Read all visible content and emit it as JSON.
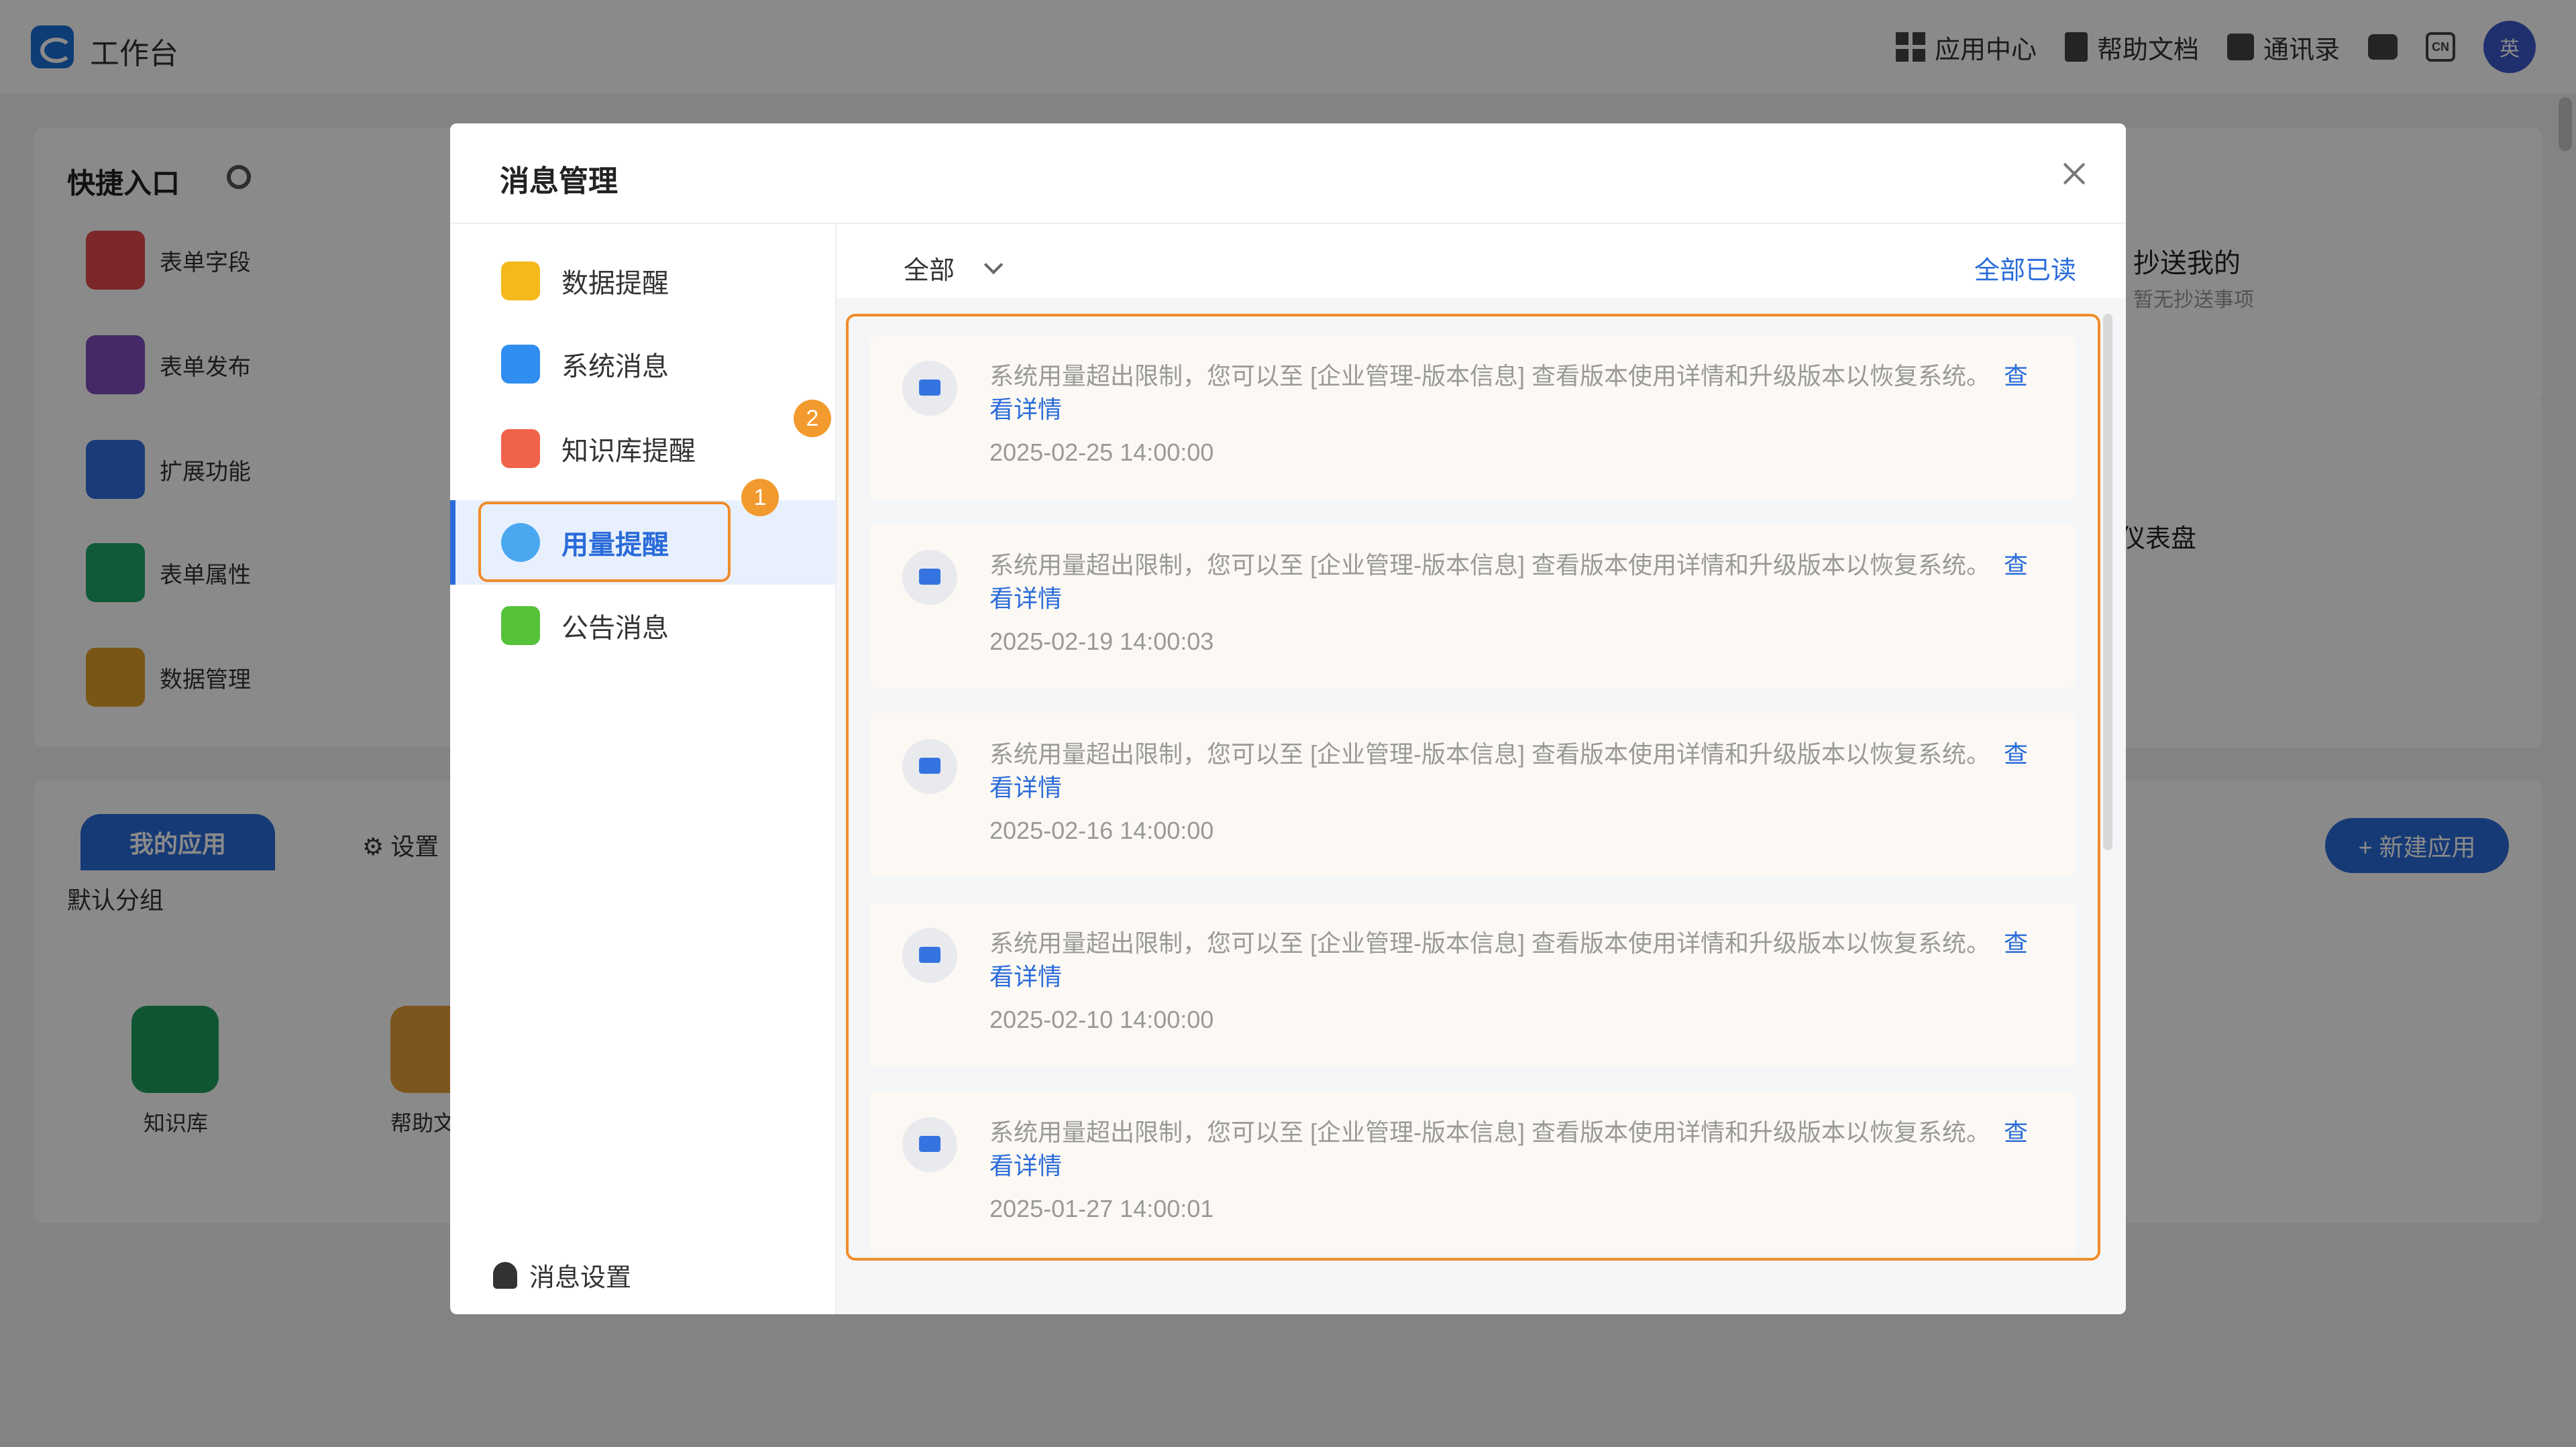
{
  "app": {
    "title": "工作台",
    "nav": [
      "应用中心",
      "帮助文档",
      "通讯录"
    ],
    "lang_icon_text": "CN",
    "avatar_text": "英"
  },
  "quick_entry": {
    "title": "快捷入口",
    "items": [
      {
        "label": "表单字段",
        "color": "#e5484d"
      },
      {
        "label": "表单发布",
        "color": "#7c4dbd"
      },
      {
        "label": "扩展功能",
        "color": "#2f6fe0"
      },
      {
        "label": "表单属性",
        "color": "#1fa56a"
      },
      {
        "label": "数据管理",
        "color": "#e0a02a"
      }
    ]
  },
  "cc_panel": {
    "title": "抄送我的",
    "sub": "暂无抄送事项"
  },
  "dashboard_partial": "仪表盘",
  "apps": {
    "tabs": [
      "我的应用",
      "设置"
    ],
    "group": "默认分组",
    "new_app": "+ 新建应用",
    "items": [
      {
        "label": "知识库",
        "color": "#21a05e"
      },
      {
        "label": "帮助文",
        "color": "#e8a03a"
      }
    ]
  },
  "modal": {
    "title": "消息管理",
    "sidebar": [
      {
        "label": "数据提醒",
        "color": "#f6b91c"
      },
      {
        "label": "系统消息",
        "color": "#2f8ef0"
      },
      {
        "label": "知识库提醒",
        "color": "#f0624a"
      },
      {
        "label": "用量提醒",
        "color": "#4aa8f0",
        "active": true
      },
      {
        "label": "公告消息",
        "color": "#55c23a"
      }
    ],
    "settings_label": "消息设置",
    "badges": [
      "1",
      "2"
    ],
    "filter": {
      "selected": "全部",
      "mark_all_read": "全部已读"
    },
    "messages": [
      {
        "text": "系统用量超出限制，您可以至 [企业管理-版本信息] 查看版本使用详情和升级版本以恢复系统。",
        "link": "查看详情",
        "time": "2025-02-25 14:00:00"
      },
      {
        "text": "系统用量超出限制，您可以至 [企业管理-版本信息] 查看版本使用详情和升级版本以恢复系统。",
        "link": "查看详情",
        "time": "2025-02-19 14:00:03"
      },
      {
        "text": "系统用量超出限制，您可以至 [企业管理-版本信息] 查看版本使用详情和升级版本以恢复系统。",
        "link": "查看详情",
        "time": "2025-02-16 14:00:00"
      },
      {
        "text": "系统用量超出限制，您可以至 [企业管理-版本信息] 查看版本使用详情和升级版本以恢复系统。",
        "link": "查看详情",
        "time": "2025-02-10 14:00:00"
      },
      {
        "text": "系统用量超出限制，您可以至 [企业管理-版本信息] 查看版本使用详情和升级版本以恢复系统。",
        "link": "查看详情",
        "time": "2025-01-27 14:00:01"
      }
    ]
  }
}
